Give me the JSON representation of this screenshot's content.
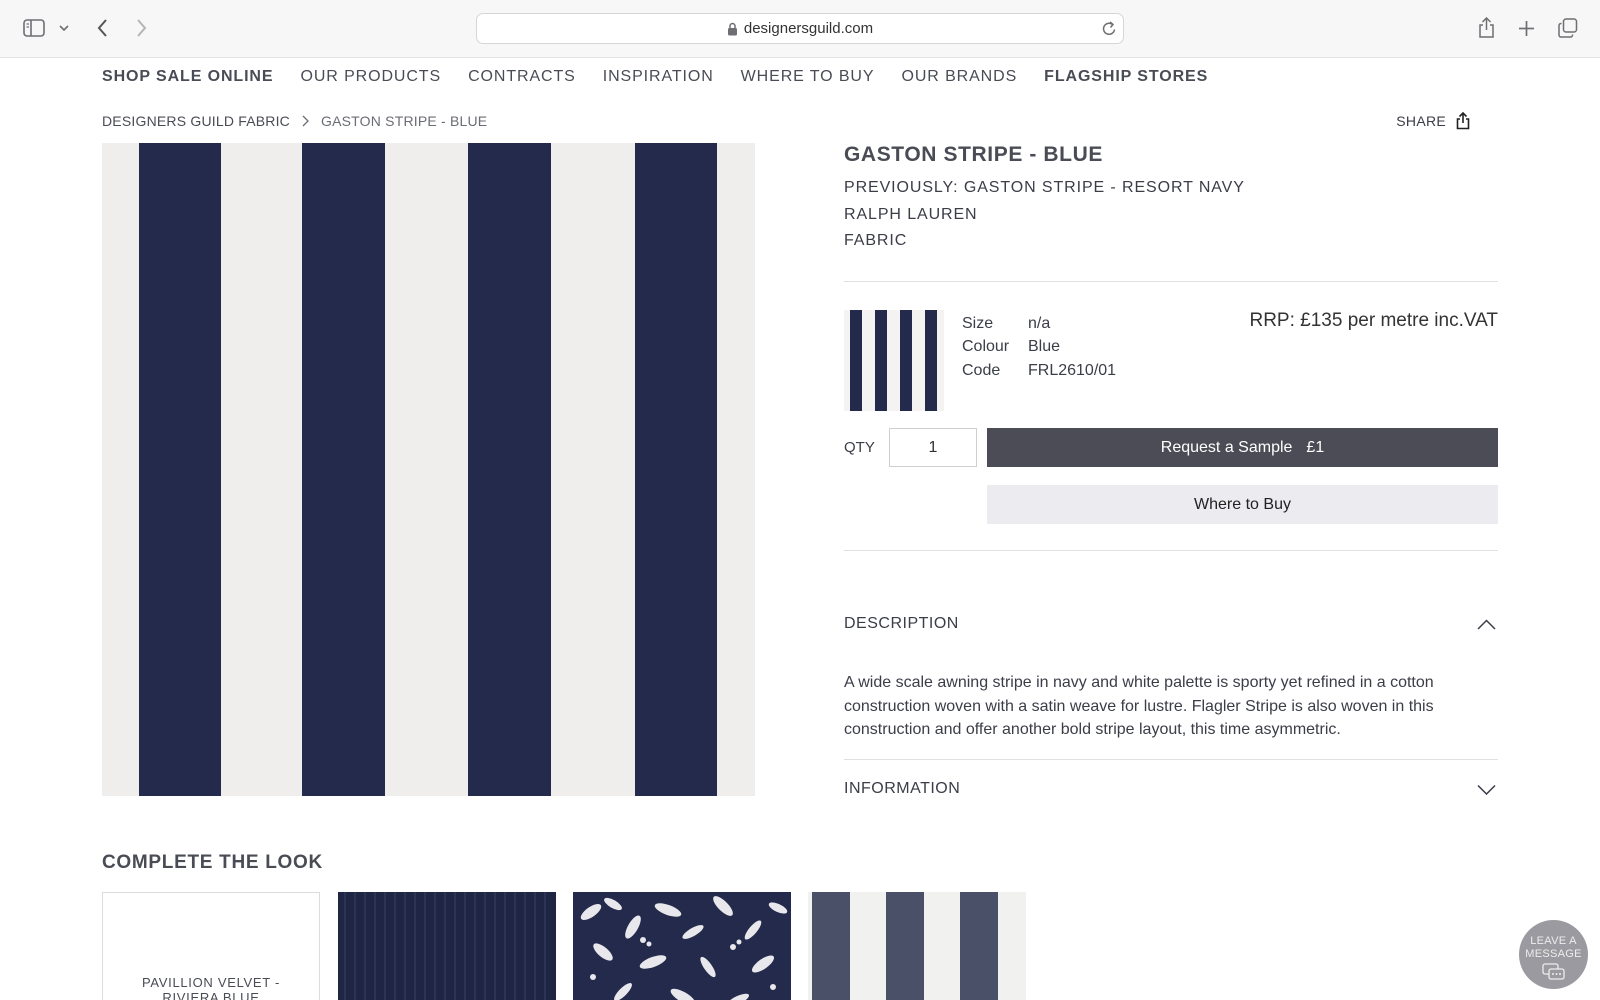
{
  "browser": {
    "url": "designersguild.com",
    "icons": [
      "sidebar-icon",
      "chevron-down-icon",
      "back-icon",
      "forward-icon",
      "lock-icon",
      "reload-icon",
      "share-icon",
      "new-tab-icon",
      "tabs-overview-icon"
    ]
  },
  "nav": {
    "items": [
      {
        "label": "SHOP SALE ONLINE",
        "bold": true
      },
      {
        "label": "OUR PRODUCTS",
        "bold": false
      },
      {
        "label": "CONTRACTS",
        "bold": false
      },
      {
        "label": "INSPIRATION",
        "bold": false
      },
      {
        "label": "WHERE TO BUY",
        "bold": false
      },
      {
        "label": "OUR BRANDS",
        "bold": false
      },
      {
        "label": "FLAGSHIP STORES",
        "bold": true
      }
    ]
  },
  "breadcrumb": {
    "parent": "DESIGNERS GUILD FABRIC",
    "current": "GASTON STRIPE - BLUE"
  },
  "share": {
    "label": "SHARE"
  },
  "product": {
    "title": "GASTON STRIPE - BLUE",
    "previously": "PREVIOUSLY: GASTON STRIPE - RESORT NAVY",
    "brand": "RALPH LAUREN",
    "category": "FABRIC",
    "specs": {
      "size_label": "Size",
      "size_value": "n/a",
      "colour_label": "Colour",
      "colour_value": "Blue",
      "code_label": "Code",
      "code_value": "FRL2610/01"
    },
    "price": "RRP: £135 per metre inc.VAT",
    "qty_label": "QTY",
    "qty_value": "1",
    "sample_label": "Request a Sample",
    "sample_price": "£1",
    "where_to_buy_label": "Where to Buy",
    "stripe_color": "#232a4c",
    "ground_color": "#efeeec"
  },
  "accordion": {
    "description_label": "DESCRIPTION",
    "description_text": "A wide scale awning stripe in navy and white palette is sporty yet refined in a cotton construction woven with a satin weave for lustre. Flagler Stripe is also woven in this construction and offer another bold stripe layout, this time asymmetric.",
    "information_label": "INFORMATION"
  },
  "complete_the_look": {
    "title": "COMPLETE THE LOOK",
    "first_card_label_line1": "PAVILLION VELVET -",
    "first_card_label_line2": "RIVIERA BLUE"
  },
  "chat": {
    "line1": "LEAVE A",
    "line2": "MESSAGE"
  }
}
